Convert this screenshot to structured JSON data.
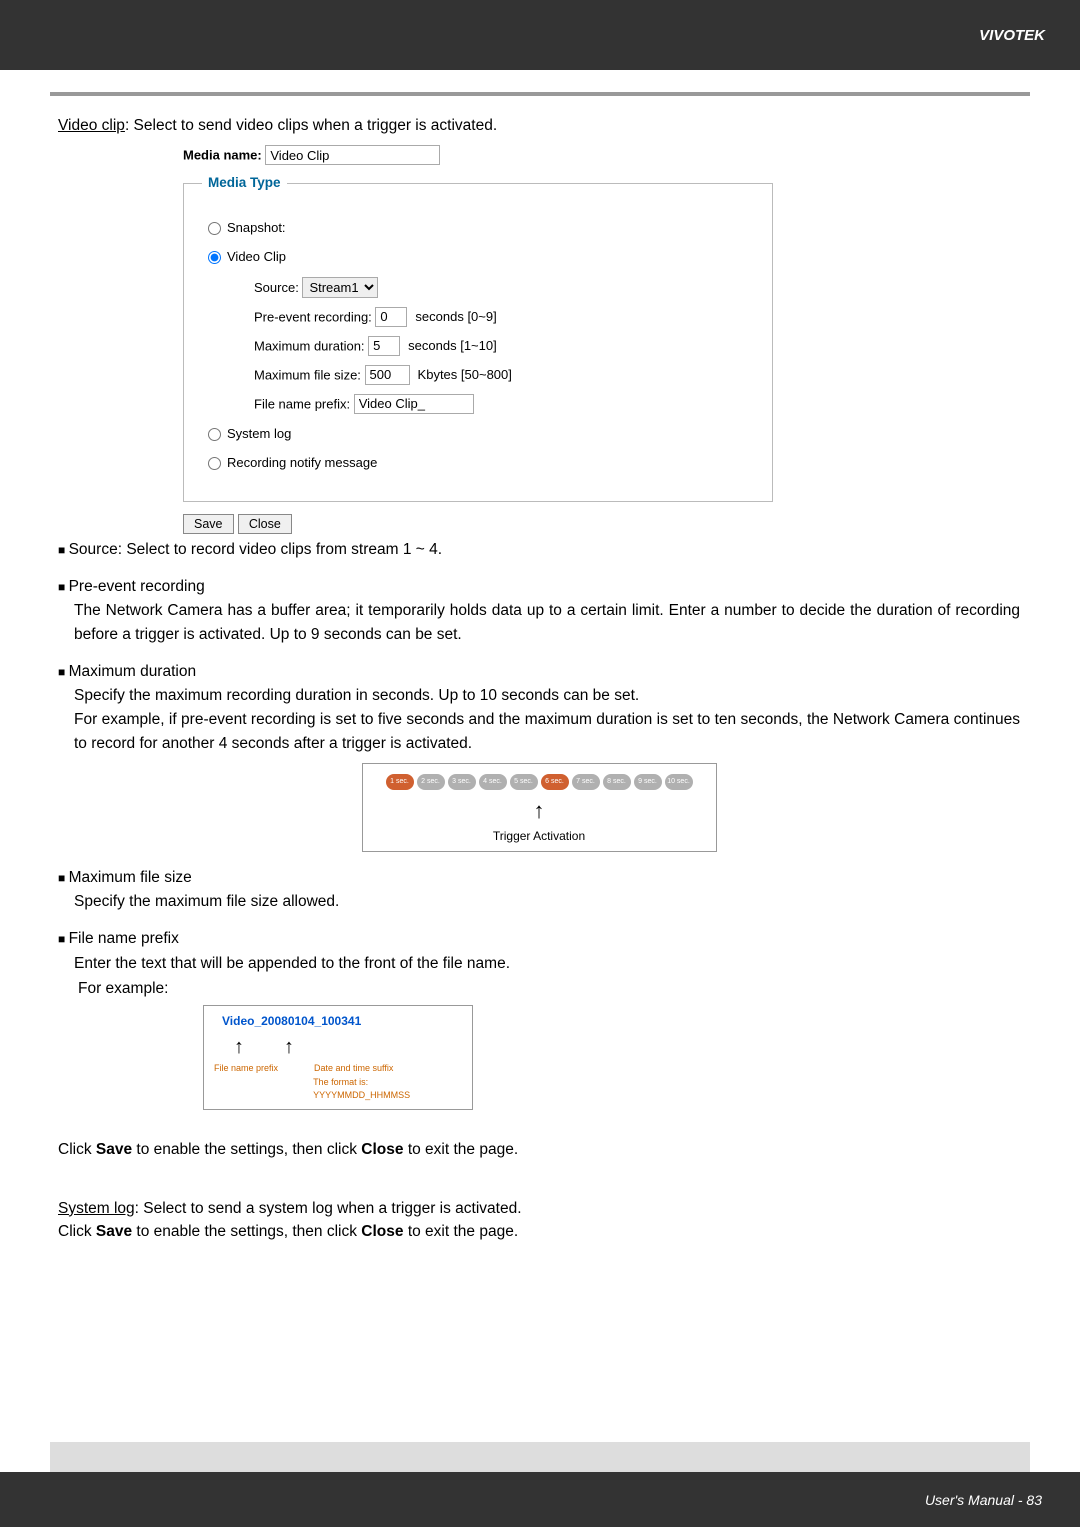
{
  "header": {
    "brand": "VIVOTEK"
  },
  "footer": {
    "text": "User's Manual - 83"
  },
  "intro": {
    "label": "Video clip",
    "text": ": Select to send video clips when a trigger is activated."
  },
  "form": {
    "media_name_label": "Media name:",
    "media_name_value": "Video Clip",
    "legend": "Media Type",
    "snapshot": "Snapshot:",
    "videoclip": "Video Clip",
    "source_label": "Source:",
    "source_value": "Stream1",
    "pre_label": "Pre-event recording:",
    "pre_value": "0",
    "pre_unit": "seconds [0~9]",
    "maxdur_label": "Maximum duration:",
    "maxdur_value": "5",
    "maxdur_unit": "seconds [1~10]",
    "maxsize_label": "Maximum file size:",
    "maxsize_value": "500",
    "maxsize_unit": "Kbytes [50~800]",
    "prefix_label": "File name prefix:",
    "prefix_value": "Video Clip_",
    "syslog": "System log",
    "recnotify": "Recording notify message",
    "save": "Save",
    "close": "Close"
  },
  "source_bullet": "Source: Select to record video clips from stream 1 ~ 4.",
  "preevent": {
    "title": "Pre-event recording",
    "body": "The Network Camera has a buffer area; it temporarily holds data up to a certain limit. Enter a number to decide the duration of recording before a trigger is activated. Up to 9 seconds can be set."
  },
  "maxdur": {
    "title": "Maximum duration",
    "body1": "Specify the maximum recording duration in seconds. Up to 10 seconds can be set.",
    "body2": "For example, if pre-event recording is set to five seconds and the maximum duration is set to ten seconds, the Network Camera continues to record for another 4 seconds after a trigger is activated."
  },
  "secs": [
    "1 sec.",
    "2 sec.",
    "3 sec.",
    "4 sec.",
    "5 sec.",
    "6 sec.",
    "7 sec.",
    "8 sec.",
    "9 sec.",
    "10 sec."
  ],
  "trigger_label": "Trigger Activation",
  "maxsize": {
    "title": "Maximum file size",
    "body": "Specify the maximum file size allowed."
  },
  "prefix": {
    "title": "File name prefix",
    "body": "Enter the text that will be appended to the front of the file name.",
    "example_label": "For example:"
  },
  "example": {
    "title": "Video_20080104_100341",
    "left": "File name prefix",
    "right1": "Date and time suffix",
    "right2": "The format is: YYYYMMDD_HHMMSS"
  },
  "save_text1": {
    "t1": "Click ",
    "t2": "Save",
    "t3": " to enable the settings, then click ",
    "t4": "Close",
    "t5": " to exit the page."
  },
  "syslog": {
    "label": "System log",
    "text": ": Select to send a system log when a trigger is activated."
  }
}
